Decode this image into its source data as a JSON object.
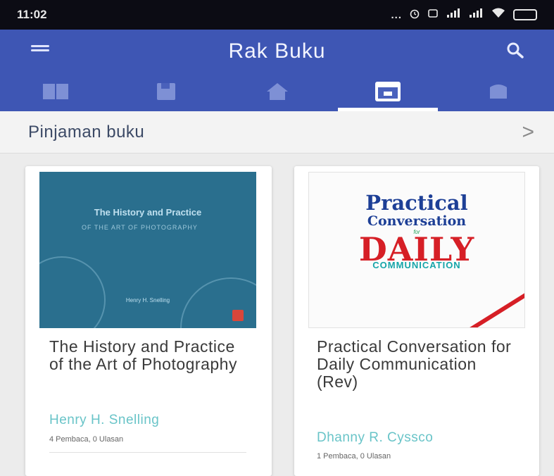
{
  "status_bar": {
    "time": "11:02",
    "signal_text": "..."
  },
  "app_bar": {
    "title": "Rak Buku",
    "tabs": [
      {
        "icon": "book-shelf-icon",
        "active": false
      },
      {
        "icon": "save-icon",
        "active": false
      },
      {
        "icon": "home-icon",
        "active": false
      },
      {
        "icon": "inbox-tray-icon",
        "active": true
      },
      {
        "icon": "library-icon",
        "active": false
      }
    ]
  },
  "section": {
    "title": "Pinjaman buku",
    "chevron": ">"
  },
  "books": [
    {
      "title": "The History and Practice of the Art of Photography",
      "author": "Henry H. Snelling",
      "stats": "4 Pembaca, 0 Ulasan",
      "cover": {
        "title": "The History and Practice",
        "subtitle": "OF THE ART OF PHOTOGRAPHY",
        "author": "Henry H. Snelling",
        "color": "#2a6f8e"
      }
    },
    {
      "title": "Practical Conversation for Daily Communication (Rev)",
      "author": "Dhanny R. Cyssco",
      "stats": "1 Pembaca, 0 Ulasan",
      "cover": {
        "line1": "Practical",
        "line2": "Conversation",
        "line3": "for",
        "line4": "DAILY",
        "line5": "COMMUNICATION"
      }
    }
  ],
  "colors": {
    "app_bar": "#3e56b4",
    "author_link": "#69c4c8",
    "status_bar": "#0c0c14"
  }
}
